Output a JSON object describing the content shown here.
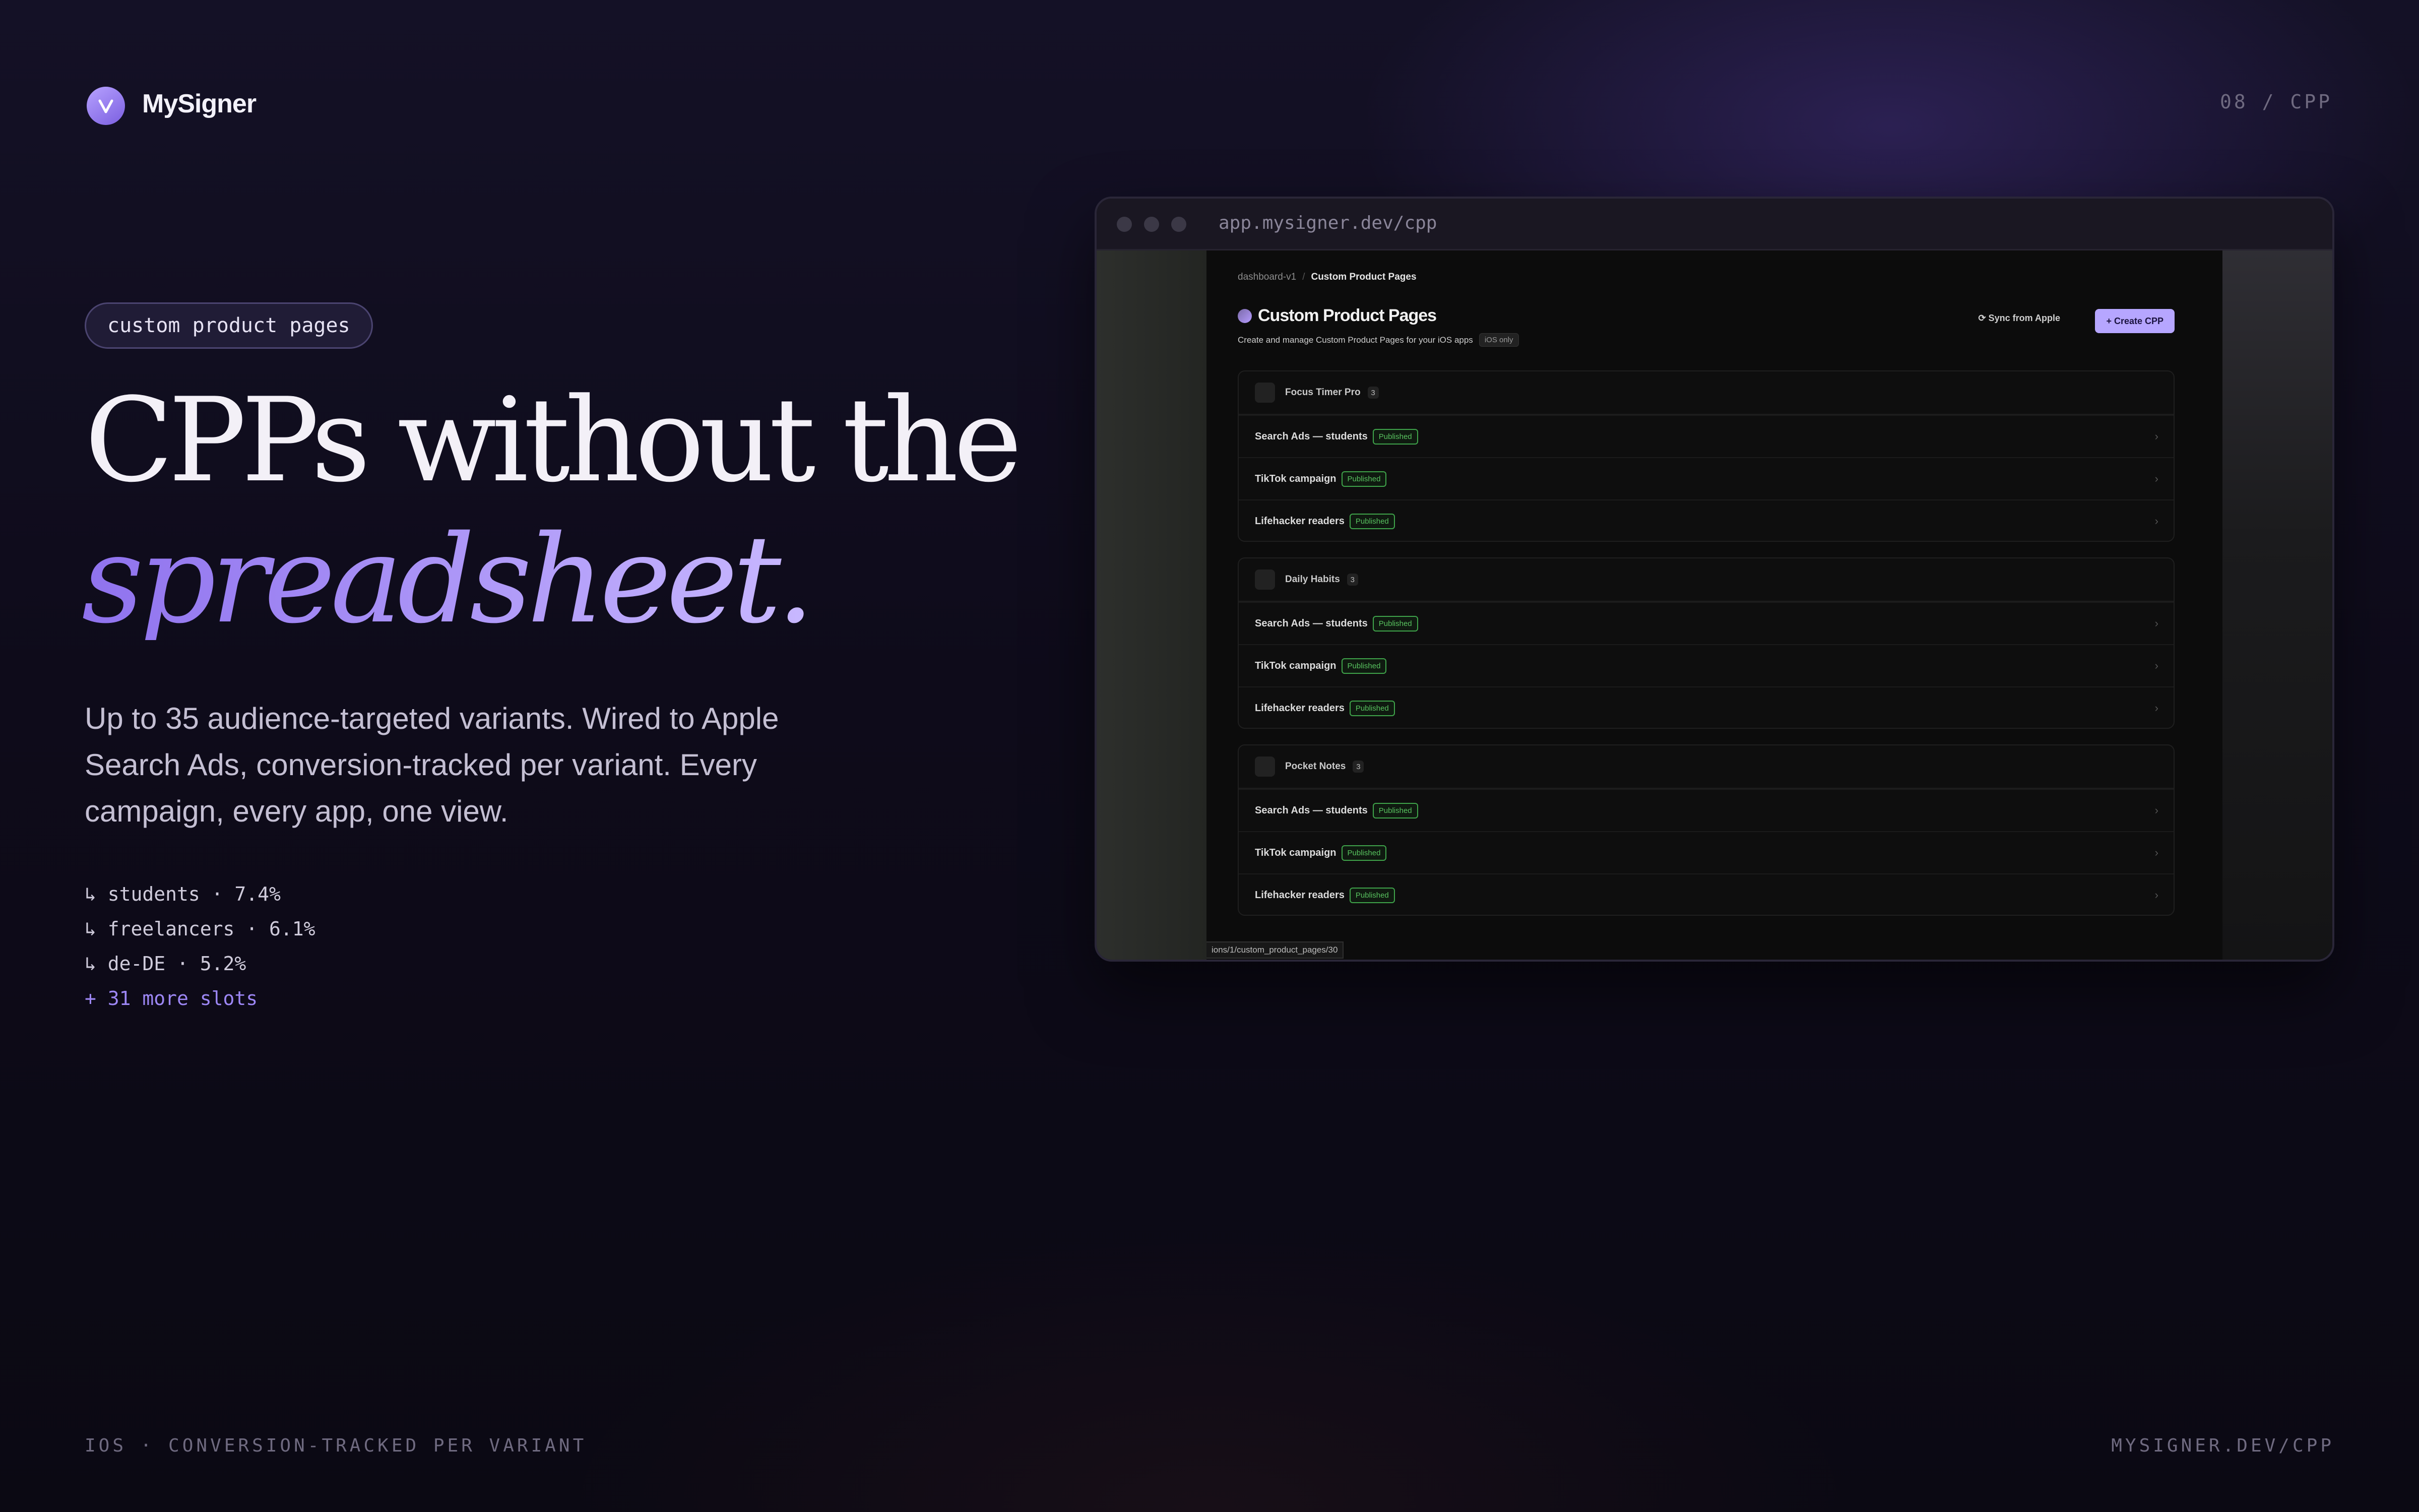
{
  "brand": {
    "name": "MySigner",
    "logo_letter": "V",
    "accent": "#8f72ee"
  },
  "slide_label": "08 / CPP",
  "pill": "custom product pages",
  "headline": {
    "line1": "CPPs without the",
    "line2": "spreadsheet."
  },
  "lede": "Up to 35 audience-targeted variants. Wired to Apple Search Ads, conversion-tracked per variant. Every campaign, every app, one view.",
  "stats": [
    "↳ students · 7.4%",
    "↳ freelancers · 6.1%",
    "↳ de-DE · 5.2%"
  ],
  "stats_more": "+ 31 more slots",
  "footer": {
    "left": "IOS · CONVERSION-TRACKED PER VARIANT",
    "right": "MYSIGNER.DEV/CPP"
  },
  "browser": {
    "url": "app.mysigner.dev/cpp",
    "breadcrumb": {
      "root": "dashboard-v1",
      "separator": "/",
      "current": "Custom Product Pages"
    },
    "title": "Custom Product Pages",
    "subtitle": "Create and manage Custom Product Pages for your iOS apps",
    "ios_chip": "iOS only",
    "sync_label": "Sync from Apple",
    "create_label": "+ Create CPP",
    "status_url": "ions/1/custom_product_pages/30",
    "badge_color": "#58c25f",
    "groups": [
      {
        "name": "Focus Timer Pro",
        "count": "3",
        "rows": [
          {
            "name": "Search Ads — students",
            "status": "Published"
          },
          {
            "name": "TikTok campaign",
            "status": "Published"
          },
          {
            "name": "Lifehacker readers",
            "status": "Published"
          }
        ]
      },
      {
        "name": "Daily Habits",
        "count": "3",
        "rows": [
          {
            "name": "Search Ads — students",
            "status": "Published"
          },
          {
            "name": "TikTok campaign",
            "status": "Published"
          },
          {
            "name": "Lifehacker readers",
            "status": "Published"
          }
        ]
      },
      {
        "name": "Pocket Notes",
        "count": "3",
        "rows": [
          {
            "name": "Search Ads — students",
            "status": "Published"
          },
          {
            "name": "TikTok campaign",
            "status": "Published"
          },
          {
            "name": "Lifehacker readers",
            "status": "Published"
          }
        ]
      }
    ]
  }
}
